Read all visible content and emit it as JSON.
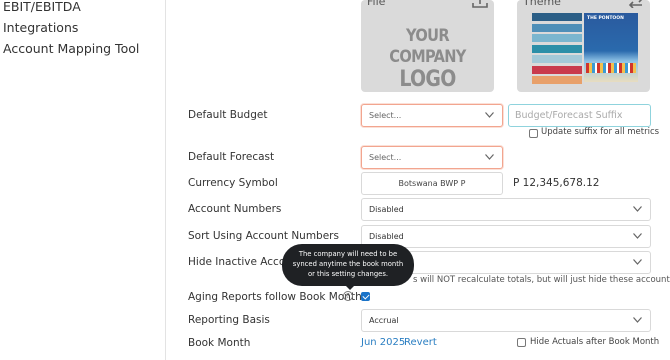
{
  "sidebar": {
    "items": [
      {
        "label": "EBIT/EBITDA"
      },
      {
        "label": "Integrations"
      },
      {
        "label": "Account Mapping Tool"
      }
    ]
  },
  "branding": {
    "file_label": "File",
    "logo_line1": "YOUR COMPANY",
    "logo_line2": "LOGO HERE",
    "theme_label": "Theme",
    "theme_image_title": "THE PONTOON",
    "swatch_colors": [
      "#2b5e86",
      "#4e8fb8",
      "#7ab6cf",
      "#2b8fa8",
      "#a3c9d8",
      "#c93a4c",
      "#e8a06a"
    ]
  },
  "settings": {
    "default_budget": {
      "label": "Default Budget",
      "value": "Select...",
      "suffix_placeholder": "Budget/Forecast Suffix",
      "update_suffix_label": "Update suffix for all metrics"
    },
    "default_forecast": {
      "label": "Default Forecast",
      "value": "Select..."
    },
    "currency_symbol": {
      "label": "Currency Symbol",
      "value": "Botswana BWP P",
      "example": "P 12,345,678.12"
    },
    "account_numbers": {
      "label": "Account Numbers",
      "value": "Disabled"
    },
    "sort_using_account_numbers": {
      "label": "Sort Using Account Numbers",
      "value": "Disabled"
    },
    "hide_inactive_accounts": {
      "label": "Hide Inactive Accounts",
      "note": "s will NOT recalculate totals, but will just hide these accounts."
    },
    "aging_reports": {
      "label": "Aging Reports follow Book Month",
      "checked": true
    },
    "reporting_basis": {
      "label": "Reporting Basis",
      "value": "Accrual"
    },
    "book_month": {
      "label": "Book Month",
      "value": "Jun 2025",
      "revert_label": "Revert",
      "hide_actuals_label": "Hide Actuals after Book Month"
    }
  },
  "tooltip": {
    "line1": "The company will need to be",
    "line2": "synced anytime the book month",
    "line3": "or this setting changes."
  },
  "colors": {
    "accent": "#1a73c8",
    "error_border": "#f2a58f",
    "focus_border": "#8fd3dd",
    "link": "#2a7ec2"
  }
}
